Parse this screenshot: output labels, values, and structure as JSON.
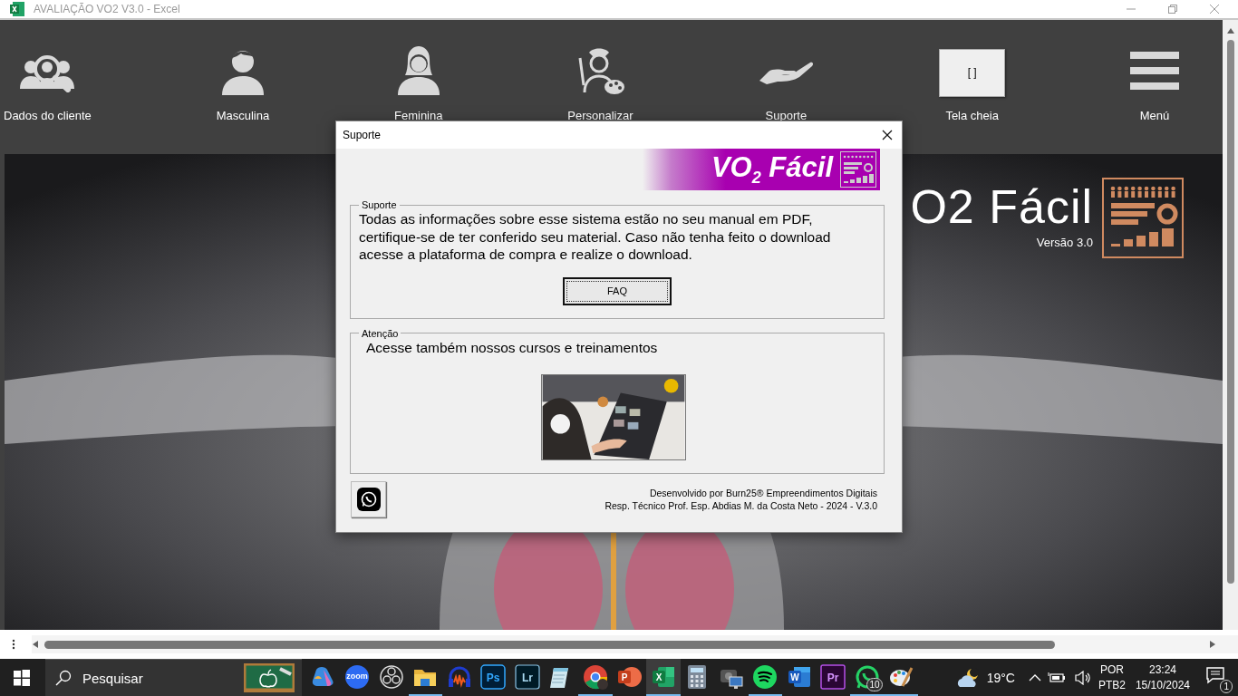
{
  "window": {
    "title": "AVALIAÇÃO VO2 V3.0 - Excel"
  },
  "toolbar": {
    "items": [
      {
        "kind": "clients",
        "label": "Dados do cliente"
      },
      {
        "kind": "male",
        "label": "Masculina"
      },
      {
        "kind": "female",
        "label": "Feminina"
      },
      {
        "kind": "customize",
        "label": "Personalizar"
      },
      {
        "kind": "support",
        "label": "Suporte"
      },
      {
        "kind": "fullscreen",
        "label": "Tela cheia",
        "button": "[ ]"
      },
      {
        "kind": "menu",
        "label": "Menú"
      }
    ]
  },
  "hero": {
    "kind": "picture",
    "title": "O2 Fácil",
    "version": "Versão 3.0"
  },
  "dialog": {
    "title": "Suporte",
    "banner": "VO$_{2}$ Fácil",
    "groups": [
      {
        "legend": "Suporte",
        "text": "Todas as informações sobre esse sistema estão no seu manual em PDF, certifique-se de ter conferido seu material. Caso não tenha feito o download acesse a plataforma de compra e realize o download.",
        "button": "FAQ"
      },
      {
        "legend": "Atenção",
        "text": "Acesse também nossos cursos e treinamentos"
      }
    ],
    "footer": [
      "Desenvolvido por Burn25® Empreendimentos Digitais",
      "Resp. Técnico Prof. Esp. Abdias M. da Costa Neto - 2024 - V.3.0"
    ]
  },
  "taskbar": {
    "search": {
      "placeholder": "Pesquisar"
    },
    "apps": [
      {
        "kind": "copilot",
        "running": false,
        "selected": false
      },
      {
        "kind": "zoom",
        "label": "zoom",
        "running": false,
        "selected": false
      },
      {
        "kind": "obs",
        "running": false,
        "selected": false
      },
      {
        "kind": "folder",
        "running": true,
        "selected": false
      },
      {
        "kind": "audio",
        "running": false,
        "selected": false
      },
      {
        "kind": "ps",
        "label": "Ps",
        "running": false,
        "selected": false
      },
      {
        "kind": "lr",
        "label": "Lr",
        "running": false,
        "selected": false
      },
      {
        "kind": "notepad",
        "running": false,
        "selected": false
      },
      {
        "kind": "chrome",
        "running": true,
        "selected": false
      },
      {
        "kind": "ppt",
        "label": "P",
        "running": false,
        "selected": false
      },
      {
        "kind": "excel",
        "label": "X",
        "running": true,
        "selected": true
      },
      {
        "kind": "calculator",
        "running": false,
        "selected": false
      },
      {
        "kind": "camera",
        "running": false,
        "selected": false
      },
      {
        "kind": "spotify",
        "running": true,
        "selected": false
      },
      {
        "kind": "word",
        "label": "W",
        "running": false,
        "selected": false
      },
      {
        "kind": "pr",
        "label": "Pr",
        "running": false,
        "selected": false
      },
      {
        "kind": "whatsapp",
        "badge": "10",
        "running": true,
        "selected": false
      },
      {
        "kind": "paint",
        "running": true,
        "selected": false
      }
    ],
    "weather": "19°C",
    "language": [
      "POR",
      "PTB2"
    ],
    "time": "23:24",
    "date": "15/10/2024",
    "notifications": "1"
  }
}
